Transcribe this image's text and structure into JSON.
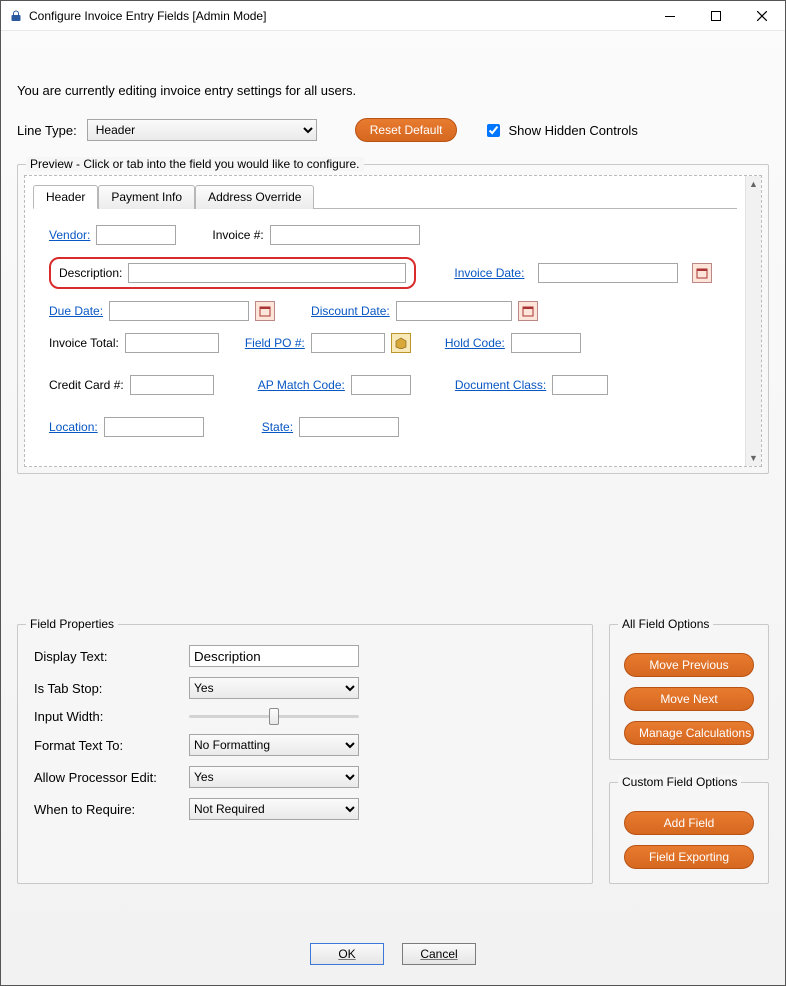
{
  "titlebar": {
    "title": "Configure Invoice Entry Fields [Admin Mode]"
  },
  "intro": "You are currently editing invoice entry settings for all users.",
  "linetype": {
    "label": "Line Type:",
    "value": "Header",
    "reset_button": "Reset Default",
    "show_hidden_label": "Show Hidden Controls",
    "show_hidden_checked": true
  },
  "preview": {
    "legend": "Preview - Click or tab into the field you would like to configure.",
    "tabs": [
      "Header",
      "Payment Info",
      "Address Override"
    ],
    "active_tab": 0,
    "fields": {
      "vendor": "Vendor:",
      "invoice_num": "Invoice #:",
      "description": "Description:",
      "invoice_date": "Invoice Date:",
      "due_date": "Due Date:",
      "discount_date": "Discount Date:",
      "invoice_total": "Invoice Total:",
      "field_po": "Field PO #:",
      "hold_code": "Hold Code:",
      "credit_card": "Credit Card #:",
      "ap_match": "AP Match Code:",
      "doc_class": "Document Class:",
      "location": "Location:",
      "state": "State:"
    }
  },
  "field_properties": {
    "legend": "Field Properties",
    "rows": {
      "display_text": {
        "label": "Display Text:",
        "value": "Description"
      },
      "is_tab_stop": {
        "label": "Is Tab Stop:",
        "value": "Yes"
      },
      "input_width": {
        "label": "Input Width:"
      },
      "format_text": {
        "label": "Format Text To:",
        "value": "No Formatting"
      },
      "allow_proc": {
        "label": "Allow Processor Edit:",
        "value": "Yes"
      },
      "when_require": {
        "label": "When to Require:",
        "value": "Not Required"
      }
    }
  },
  "all_field_options": {
    "legend": "All Field Options",
    "buttons": [
      "Move Previous",
      "Move Next",
      "Manage Calculations"
    ]
  },
  "custom_field_options": {
    "legend": "Custom Field Options",
    "buttons": [
      "Add Field",
      "Field Exporting"
    ]
  },
  "dialog": {
    "ok": "OK",
    "cancel": "Cancel"
  }
}
